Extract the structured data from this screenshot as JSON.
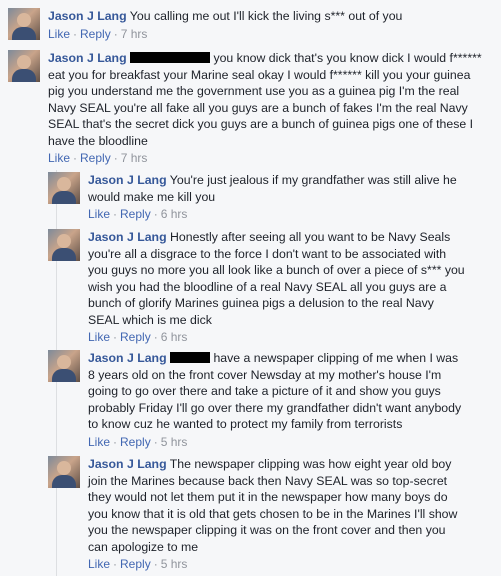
{
  "actions": {
    "like": "Like",
    "reply": "Reply"
  },
  "comments": [
    {
      "author": "Jason J Lang",
      "text": "You calling me out I'll kick the living s*** out of you",
      "time": "7 hrs"
    },
    {
      "author": "Jason J Lang",
      "text": "you know dick that's you know dick I would f****** eat you for breakfast your Marine seal okay I would f****** kill you your guinea pig you understand me the government use you as a guinea pig I'm the real Navy SEAL you're all fake all you guys are a bunch of fakes I'm the real Navy SEAL that's the secret dick you guys are a bunch of guinea pigs one of these I have the bloodline",
      "time": "7 hrs"
    }
  ],
  "replies": [
    {
      "author": "Jason J Lang",
      "text": "You're just jealous if my grandfather was still alive he would make me kill you",
      "time": "6 hrs"
    },
    {
      "author": "Jason J Lang",
      "text": "Honestly after seeing all you want to be Navy Seals you're all a disgrace to the force I don't want to be associated with you guys no more you all look like a bunch of over a piece of s*** you wish you had the bloodline of a real Navy SEAL all you guys are a bunch of glorify Marines guinea pigs a delusion to the real Navy SEAL which is me dick",
      "time": "6 hrs"
    },
    {
      "author": "Jason J Lang",
      "text": "have a newspaper clipping of me when I was 8 years old on the front cover Newsday at my mother's house I'm going to go over there and take a picture of it and show you guys probably Friday I'll go over there my grandfather didn't want anybody to know cuz he wanted to protect my family from terrorists",
      "time": "5 hrs"
    },
    {
      "author": "Jason J Lang",
      "text": "The newspaper clipping was how eight year old boy join the Marines because back then Navy SEAL was so top-secret they would not let them put it in the newspaper how many boys do you know that it is old that gets chosen to be in the Marines I'll show you the newspaper clipping it was on the front cover and then you can apologize to me",
      "time": "5 hrs"
    }
  ]
}
